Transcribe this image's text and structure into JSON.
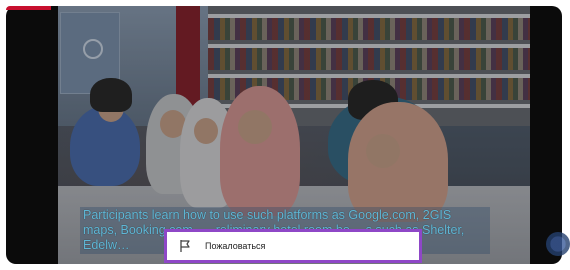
{
  "video": {
    "caption": "Participants learn how to use such platforms as Google.com, 2GIS maps, Booking.com, … reliminary hotel room bo… s such as Shelter, Edelw…"
  },
  "context_menu": {
    "items": [
      {
        "label": "Пожаловаться",
        "icon": "flag-icon"
      }
    ],
    "border_color": "#8e47c7"
  },
  "colors": {
    "frame": "#0b0b0b",
    "caption_text": "#5fb7d6",
    "accent_strip": "#c8102e"
  }
}
